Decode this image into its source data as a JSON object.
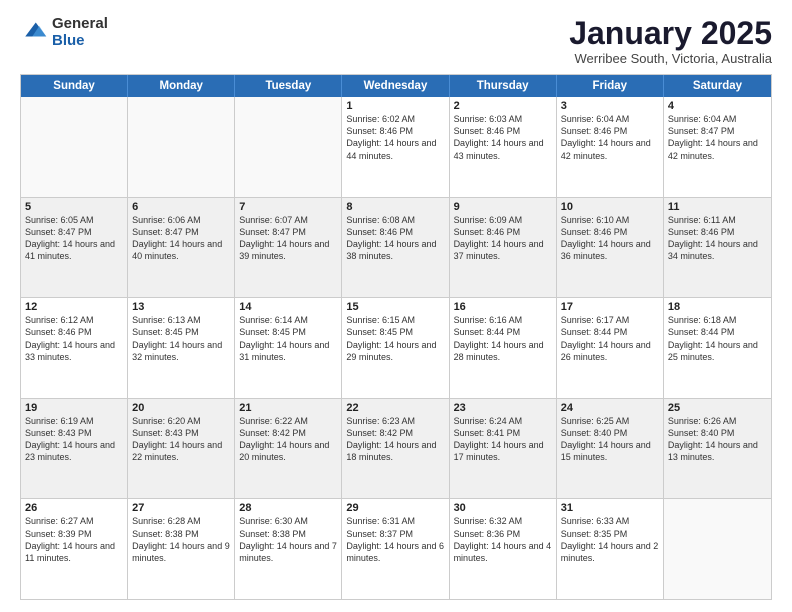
{
  "logo": {
    "general": "General",
    "blue": "Blue"
  },
  "header": {
    "month": "January 2025",
    "location": "Werribee South, Victoria, Australia"
  },
  "weekdays": [
    "Sunday",
    "Monday",
    "Tuesday",
    "Wednesday",
    "Thursday",
    "Friday",
    "Saturday"
  ],
  "rows": [
    [
      {
        "day": "",
        "text": ""
      },
      {
        "day": "",
        "text": ""
      },
      {
        "day": "",
        "text": ""
      },
      {
        "day": "1",
        "text": "Sunrise: 6:02 AM\nSunset: 8:46 PM\nDaylight: 14 hours\nand 44 minutes."
      },
      {
        "day": "2",
        "text": "Sunrise: 6:03 AM\nSunset: 8:46 PM\nDaylight: 14 hours\nand 43 minutes."
      },
      {
        "day": "3",
        "text": "Sunrise: 6:04 AM\nSunset: 8:46 PM\nDaylight: 14 hours\nand 42 minutes."
      },
      {
        "day": "4",
        "text": "Sunrise: 6:04 AM\nSunset: 8:47 PM\nDaylight: 14 hours\nand 42 minutes."
      }
    ],
    [
      {
        "day": "5",
        "text": "Sunrise: 6:05 AM\nSunset: 8:47 PM\nDaylight: 14 hours\nand 41 minutes."
      },
      {
        "day": "6",
        "text": "Sunrise: 6:06 AM\nSunset: 8:47 PM\nDaylight: 14 hours\nand 40 minutes."
      },
      {
        "day": "7",
        "text": "Sunrise: 6:07 AM\nSunset: 8:47 PM\nDaylight: 14 hours\nand 39 minutes."
      },
      {
        "day": "8",
        "text": "Sunrise: 6:08 AM\nSunset: 8:46 PM\nDaylight: 14 hours\nand 38 minutes."
      },
      {
        "day": "9",
        "text": "Sunrise: 6:09 AM\nSunset: 8:46 PM\nDaylight: 14 hours\nand 37 minutes."
      },
      {
        "day": "10",
        "text": "Sunrise: 6:10 AM\nSunset: 8:46 PM\nDaylight: 14 hours\nand 36 minutes."
      },
      {
        "day": "11",
        "text": "Sunrise: 6:11 AM\nSunset: 8:46 PM\nDaylight: 14 hours\nand 34 minutes."
      }
    ],
    [
      {
        "day": "12",
        "text": "Sunrise: 6:12 AM\nSunset: 8:46 PM\nDaylight: 14 hours\nand 33 minutes."
      },
      {
        "day": "13",
        "text": "Sunrise: 6:13 AM\nSunset: 8:45 PM\nDaylight: 14 hours\nand 32 minutes."
      },
      {
        "day": "14",
        "text": "Sunrise: 6:14 AM\nSunset: 8:45 PM\nDaylight: 14 hours\nand 31 minutes."
      },
      {
        "day": "15",
        "text": "Sunrise: 6:15 AM\nSunset: 8:45 PM\nDaylight: 14 hours\nand 29 minutes."
      },
      {
        "day": "16",
        "text": "Sunrise: 6:16 AM\nSunset: 8:44 PM\nDaylight: 14 hours\nand 28 minutes."
      },
      {
        "day": "17",
        "text": "Sunrise: 6:17 AM\nSunset: 8:44 PM\nDaylight: 14 hours\nand 26 minutes."
      },
      {
        "day": "18",
        "text": "Sunrise: 6:18 AM\nSunset: 8:44 PM\nDaylight: 14 hours\nand 25 minutes."
      }
    ],
    [
      {
        "day": "19",
        "text": "Sunrise: 6:19 AM\nSunset: 8:43 PM\nDaylight: 14 hours\nand 23 minutes."
      },
      {
        "day": "20",
        "text": "Sunrise: 6:20 AM\nSunset: 8:43 PM\nDaylight: 14 hours\nand 22 minutes."
      },
      {
        "day": "21",
        "text": "Sunrise: 6:22 AM\nSunset: 8:42 PM\nDaylight: 14 hours\nand 20 minutes."
      },
      {
        "day": "22",
        "text": "Sunrise: 6:23 AM\nSunset: 8:42 PM\nDaylight: 14 hours\nand 18 minutes."
      },
      {
        "day": "23",
        "text": "Sunrise: 6:24 AM\nSunset: 8:41 PM\nDaylight: 14 hours\nand 17 minutes."
      },
      {
        "day": "24",
        "text": "Sunrise: 6:25 AM\nSunset: 8:40 PM\nDaylight: 14 hours\nand 15 minutes."
      },
      {
        "day": "25",
        "text": "Sunrise: 6:26 AM\nSunset: 8:40 PM\nDaylight: 14 hours\nand 13 minutes."
      }
    ],
    [
      {
        "day": "26",
        "text": "Sunrise: 6:27 AM\nSunset: 8:39 PM\nDaylight: 14 hours\nand 11 minutes."
      },
      {
        "day": "27",
        "text": "Sunrise: 6:28 AM\nSunset: 8:38 PM\nDaylight: 14 hours\nand 9 minutes."
      },
      {
        "day": "28",
        "text": "Sunrise: 6:30 AM\nSunset: 8:38 PM\nDaylight: 14 hours\nand 7 minutes."
      },
      {
        "day": "29",
        "text": "Sunrise: 6:31 AM\nSunset: 8:37 PM\nDaylight: 14 hours\nand 6 minutes."
      },
      {
        "day": "30",
        "text": "Sunrise: 6:32 AM\nSunset: 8:36 PM\nDaylight: 14 hours\nand 4 minutes."
      },
      {
        "day": "31",
        "text": "Sunrise: 6:33 AM\nSunset: 8:35 PM\nDaylight: 14 hours\nand 2 minutes."
      },
      {
        "day": "",
        "text": ""
      }
    ]
  ]
}
